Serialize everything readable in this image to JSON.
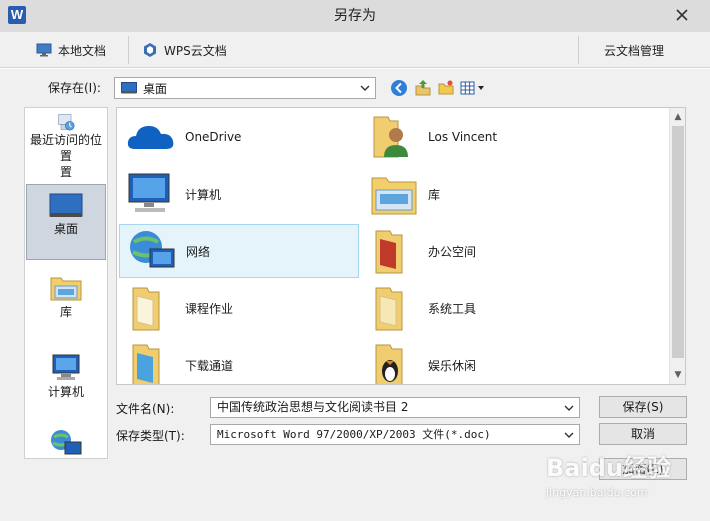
{
  "window": {
    "title": "另存为",
    "app_icon_letter": "W"
  },
  "tabs": [
    {
      "label": "本地文档",
      "icon": "monitor-icon"
    },
    {
      "label": "WPS云文档",
      "icon": "wps-cloud-icon"
    },
    {
      "label": "云文档管理"
    }
  ],
  "save_in": {
    "label": "保存在(I):",
    "value": "桌面"
  },
  "places": [
    {
      "label": "最近访问的位置",
      "label2": "置",
      "icon": "recent-places-icon"
    },
    {
      "label": "桌面",
      "icon": "desktop-icon",
      "selected": true
    },
    {
      "label": "库",
      "icon": "library-icon"
    },
    {
      "label": "计算机",
      "icon": "computer-icon"
    },
    {
      "label": "",
      "icon": "network-icon"
    }
  ],
  "files": [
    {
      "name": "OneDrive",
      "icon": "onedrive-icon"
    },
    {
      "name": "Los Vincent",
      "icon": "user-folder-icon"
    },
    {
      "name": "计算机",
      "icon": "computer-icon"
    },
    {
      "name": "库",
      "icon": "library-icon"
    },
    {
      "name": "网络",
      "icon": "network-icon",
      "selected": true
    },
    {
      "name": "办公空间",
      "icon": "folder-icon"
    },
    {
      "name": "课程作业",
      "icon": "folder-icon"
    },
    {
      "name": "系统工具",
      "icon": "folder-icon"
    },
    {
      "name": "下载通道",
      "icon": "folder-icon"
    },
    {
      "name": "娱乐休闲",
      "icon": "folder-icon"
    }
  ],
  "filename": {
    "label": "文件名(N):",
    "value": "中国传统政治思想与文化阅读书目 2"
  },
  "filetype": {
    "label": "保存类型(T):",
    "value": "Microsoft Word 97/2000/XP/2003 文件(*.doc)"
  },
  "buttons": {
    "save": "保存(S)",
    "cancel": "取消",
    "encrypt": "加密(E)"
  },
  "watermark": {
    "main": "Baidu经验",
    "sub": "jingyan.baidu.com"
  },
  "colors": {
    "accent": "#2a5db0",
    "selection": "#e5f3fb"
  }
}
